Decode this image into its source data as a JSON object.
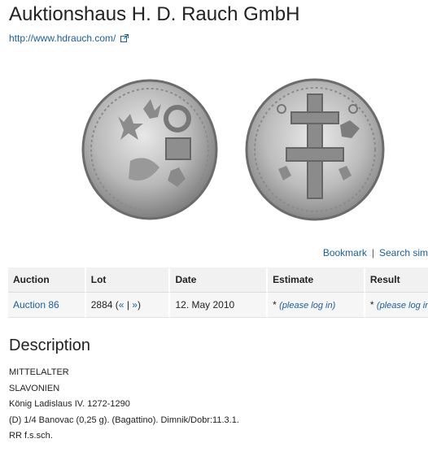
{
  "header": {
    "title": "Auktionshaus H. D. Rauch GmbH",
    "website": "http://www.hdrauch.com/"
  },
  "toolbar": {
    "bookmark": "Bookmark",
    "separator": "|",
    "search": "Search sim"
  },
  "table": {
    "headers": [
      "Auction",
      "Lot",
      "Date",
      "Estimate",
      "Result"
    ],
    "row": {
      "auction": "Auction 86",
      "lot_number": "2884",
      "lot_prev": "«",
      "lot_sep": "|",
      "lot_next": "»",
      "date": "12. May 2010",
      "estimate_star": "*",
      "estimate_link": "(please log in)",
      "result_star": "*",
      "result_link": "(please log in)"
    }
  },
  "description": {
    "heading": "Description",
    "lines": [
      "MITTELALTER",
      "SLAVONIEN",
      "König Ladislaus IV. 1272-1290",
      "(D) 1/4 Banovac (0,25 g). (Bagattino). Dimnik/Dobr:11.3.1.",
      "RR f.s.sch."
    ]
  },
  "icons": {
    "external_link": "external-link-icon"
  }
}
